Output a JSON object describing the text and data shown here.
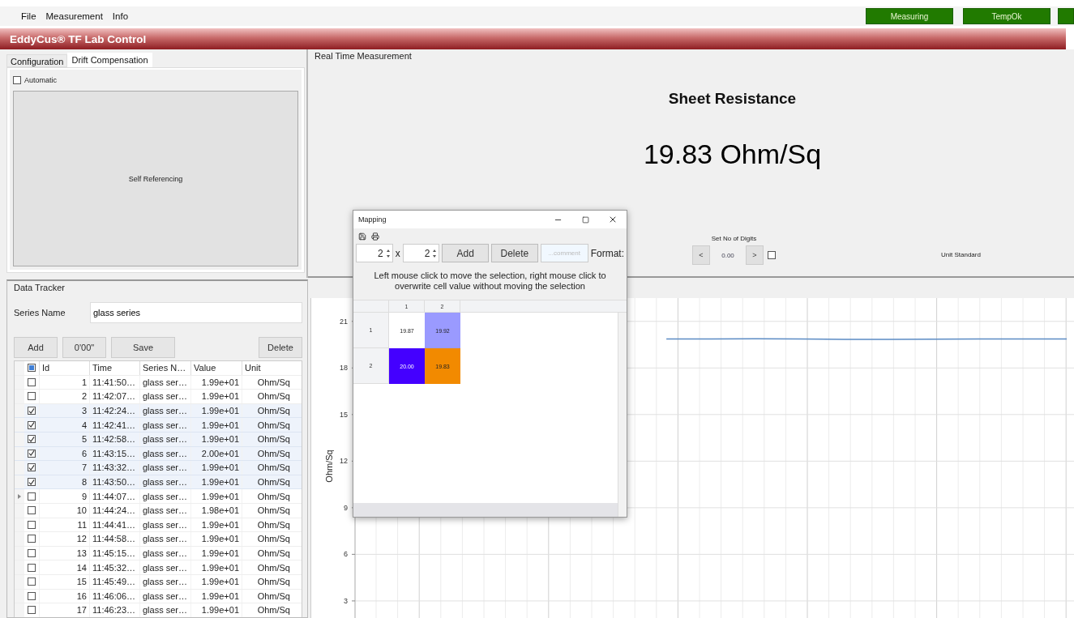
{
  "menu": [
    "File",
    "Measurement",
    "Info"
  ],
  "statuses": [
    {
      "label": "Measuring"
    },
    {
      "label": "TempOk"
    }
  ],
  "app_title": "EddyCus® TF Lab Control",
  "left_tabs": [
    {
      "label": "Configuration",
      "selected": false
    },
    {
      "label": "Drift Compensation",
      "selected": true
    }
  ],
  "drift": {
    "automatic": {
      "label": "Automatic",
      "checked": false
    },
    "self_ref_button": "Self Referencing"
  },
  "realtime": {
    "title": "Real Time Measurement",
    "heading": "Sheet Resistance",
    "reading": "19.83 Ohm/Sq",
    "digits_label": "Set No of Digits",
    "prev": "<",
    "digits_value": "0.00",
    "next": ">",
    "digits_checked": false,
    "unit": "Unit Standard"
  },
  "tracker": {
    "title": "Data Tracker",
    "series_label": "Series Name",
    "series_value": "glass series",
    "buttons": [
      "Add",
      "0'00\"",
      "Save",
      "Delete"
    ],
    "select_all": {
      "indeterminate": true
    },
    "columns": [
      "Id",
      "Time",
      "Series N…",
      "Value",
      "Unit"
    ],
    "rows": [
      {
        "id": "1",
        "time": "11:41:50…",
        "series": "glass ser…",
        "value": "1.99e+01",
        "unit": "Ohm/Sq",
        "checked": false,
        "selected": false,
        "current": false
      },
      {
        "id": "2",
        "time": "11:42:07…",
        "series": "glass ser…",
        "value": "1.99e+01",
        "unit": "Ohm/Sq",
        "checked": false,
        "selected": false,
        "current": false
      },
      {
        "id": "3",
        "time": "11:42:24…",
        "series": "glass ser…",
        "value": "1.99e+01",
        "unit": "Ohm/Sq",
        "checked": true,
        "selected": true,
        "current": false
      },
      {
        "id": "4",
        "time": "11:42:41…",
        "series": "glass ser…",
        "value": "1.99e+01",
        "unit": "Ohm/Sq",
        "checked": true,
        "selected": true,
        "current": false
      },
      {
        "id": "5",
        "time": "11:42:58…",
        "series": "glass ser…",
        "value": "1.99e+01",
        "unit": "Ohm/Sq",
        "checked": true,
        "selected": true,
        "current": false
      },
      {
        "id": "6",
        "time": "11:43:15…",
        "series": "glass ser…",
        "value": "2.00e+01",
        "unit": "Ohm/Sq",
        "checked": true,
        "selected": true,
        "current": false
      },
      {
        "id": "7",
        "time": "11:43:32…",
        "series": "glass ser…",
        "value": "1.99e+01",
        "unit": "Ohm/Sq",
        "checked": true,
        "selected": true,
        "current": false
      },
      {
        "id": "8",
        "time": "11:43:50…",
        "series": "glass ser…",
        "value": "1.99e+01",
        "unit": "Ohm/Sq",
        "checked": true,
        "selected": true,
        "current": false
      },
      {
        "id": "9",
        "time": "11:44:07…",
        "series": "glass ser…",
        "value": "1.99e+01",
        "unit": "Ohm/Sq",
        "checked": false,
        "selected": false,
        "current": true
      },
      {
        "id": "10",
        "time": "11:44:24…",
        "series": "glass ser…",
        "value": "1.98e+01",
        "unit": "Ohm/Sq",
        "checked": false,
        "selected": false,
        "current": false
      },
      {
        "id": "11",
        "time": "11:44:41…",
        "series": "glass ser…",
        "value": "1.99e+01",
        "unit": "Ohm/Sq",
        "checked": false,
        "selected": false,
        "current": false
      },
      {
        "id": "12",
        "time": "11:44:58…",
        "series": "glass ser…",
        "value": "1.99e+01",
        "unit": "Ohm/Sq",
        "checked": false,
        "selected": false,
        "current": false
      },
      {
        "id": "13",
        "time": "11:45:15…",
        "series": "glass ser…",
        "value": "1.99e+01",
        "unit": "Ohm/Sq",
        "checked": false,
        "selected": false,
        "current": false
      },
      {
        "id": "14",
        "time": "11:45:32…",
        "series": "glass ser…",
        "value": "1.99e+01",
        "unit": "Ohm/Sq",
        "checked": false,
        "selected": false,
        "current": false
      },
      {
        "id": "15",
        "time": "11:45:49…",
        "series": "glass ser…",
        "value": "1.99e+01",
        "unit": "Ohm/Sq",
        "checked": false,
        "selected": false,
        "current": false
      },
      {
        "id": "16",
        "time": "11:46:06…",
        "series": "glass ser…",
        "value": "1.99e+01",
        "unit": "Ohm/Sq",
        "checked": false,
        "selected": false,
        "current": false
      },
      {
        "id": "17",
        "time": "11:46:23…",
        "series": "glass ser…",
        "value": "1.99e+01",
        "unit": "Ohm/Sq",
        "checked": false,
        "selected": false,
        "current": false
      }
    ]
  },
  "chart": {
    "chart_data": {
      "type": "line",
      "ylabel": "Ohm/Sq",
      "ylim": [
        1.9,
        22.5
      ],
      "yticks": [
        3,
        6,
        9,
        12,
        15,
        18,
        21
      ],
      "grid": true,
      "series": [
        {
          "color": "#5b8bc4",
          "values": [
            null,
            null,
            null,
            null,
            null,
            null,
            null,
            19.87,
            19.87,
            19.88,
            19.86,
            19.84,
            19.84,
            19.85,
            19.86,
            19.86,
            19.87
          ]
        }
      ]
    }
  },
  "mapping": {
    "title": "Mapping",
    "rows_value": "2",
    "times": "x",
    "cols_value": "2",
    "add": "Add",
    "delete": "Delete",
    "comment_placeholder": "...comment",
    "format_label": "Format:",
    "hint": "Left mouse click to move the selection, right mouse click to overwrite cell value without moving the selection",
    "col_headers": [
      "1",
      "2"
    ],
    "grid": [
      {
        "header": "1",
        "cells": [
          {
            "value": "19.87",
            "color": "#ffffff"
          },
          {
            "value": "19.92",
            "color": "#9a9aff"
          }
        ]
      },
      {
        "header": "2",
        "cells": [
          {
            "value": "20.00",
            "color": "#4400ff"
          },
          {
            "value": "19.83",
            "color": "#f28a00"
          }
        ]
      }
    ]
  }
}
